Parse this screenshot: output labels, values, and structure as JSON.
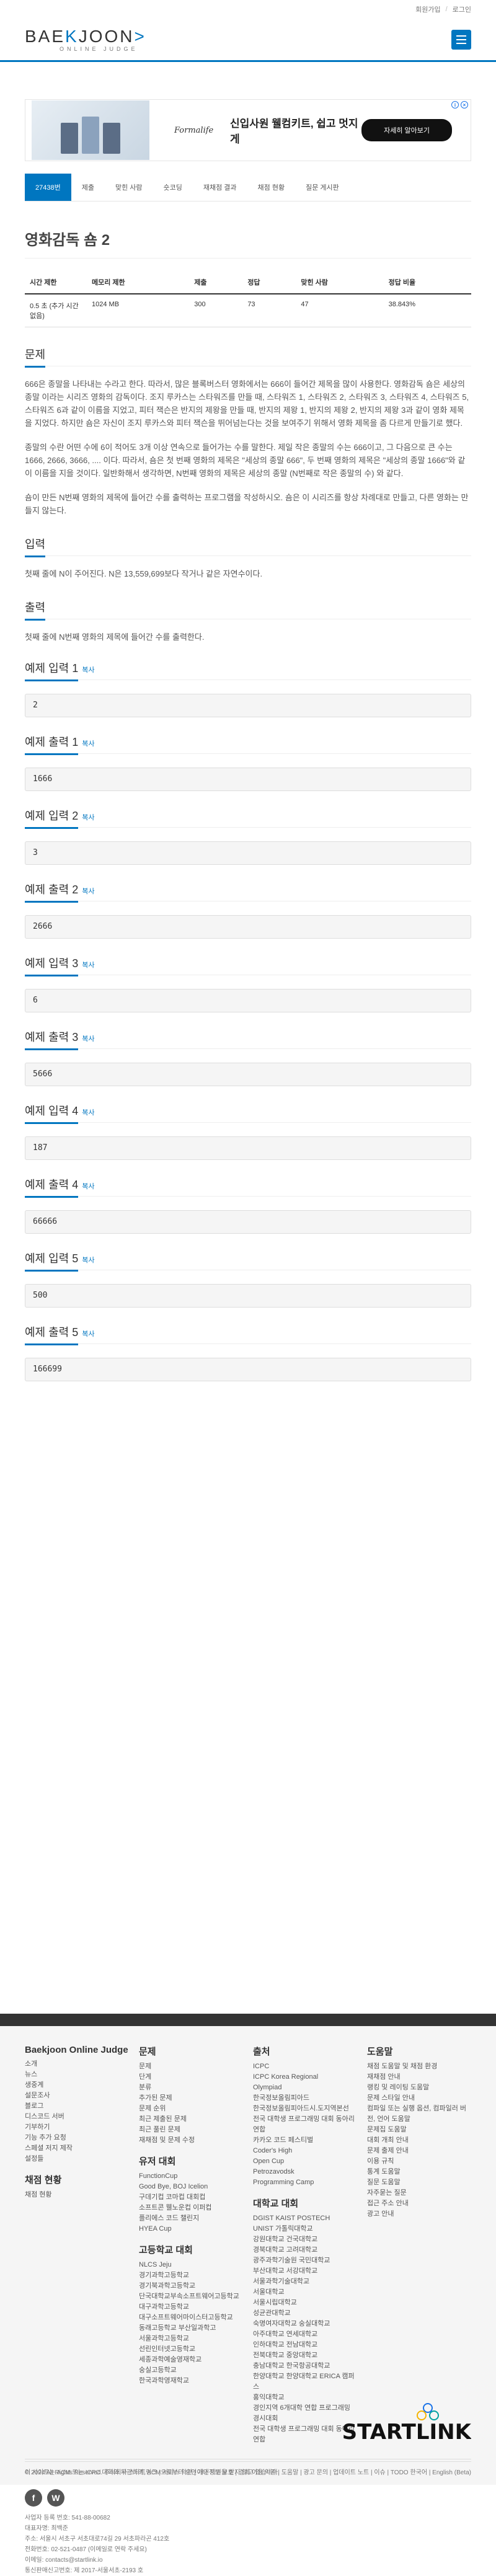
{
  "topbar": {
    "signup": "회원가입",
    "login": "로그인"
  },
  "logo": {
    "main_left": "BAE",
    "main_k": "K",
    "main_right": "JOON",
    "sub": "ONLINE JUDGE"
  },
  "ad": {
    "brand": "Formalife",
    "headline": "신입사원 웰컴키트, 쉽고 멋지게",
    "cta": "자세히 알아보기"
  },
  "tabs": [
    "27438번",
    "제출",
    "맞힌 사람",
    "숏코딩",
    "재채점 결과",
    "채점 현황",
    "질문 게시판"
  ],
  "problem": {
    "title": "영화감독 숌 2",
    "headers": [
      "시간 제한",
      "메모리 제한",
      "제출",
      "정답",
      "맞힌 사람",
      "정답 비율"
    ],
    "values": [
      "0.5 초 (추가 시간 없음)",
      "1024 MB",
      "300",
      "73",
      "47",
      "38.843%"
    ]
  },
  "sections": {
    "desc_title": "문제",
    "desc_p1": "666은 종말을 나타내는 수라고 한다. 따라서, 많은 블록버스터 영화에서는 666이 들어간 제목을 많이 사용한다. 영화감독 숌은 세상의 종말 이라는 시리즈 영화의 감독이다. 조지 루카스는 스타워즈를 만들 때, 스타워즈 1, 스타워즈 2, 스타워즈 3, 스타워즈 4, 스타워즈 5, 스타워즈 6과 같이 이름을 지었고, 피터 잭슨은 반지의 제왕을 만들 때, 반지의 제왕 1, 반지의 제왕 2, 반지의 제왕 3과 같이 영화 제목을 지었다. 하지만 숌은 자신이 조지 루카스와 피터 잭슨을 뛰어넘는다는 것을 보여주기 위해서 영화 제목을 좀 다르게 만들기로 했다.",
    "desc_p2": "종말의 수란 어떤 수에 6이 적어도 3개 이상 연속으로 들어가는 수를 말한다. 제일 작은 종말의 수는 666이고, 그 다음으로 큰 수는 1666, 2666, 3666, .... 이다. 따라서, 숌은 첫 번째 영화의 제목은 \"세상의 종말 666\", 두 번째 영화의 제목은 \"세상의 종말 1666\"와 같이 이름을 지을 것이다. 일반화해서 생각하면, N번째 영화의 제목은 세상의 종말 (N번째로 작은 종말의 수) 와 같다.",
    "desc_p3": "숌이 만든 N번째 영화의 제목에 들어간 수를 출력하는 프로그램을 작성하시오. 숌은 이 시리즈를 항상 차례대로 만들고, 다른 영화는 만들지 않는다.",
    "input_title": "입력",
    "input_p": "첫째 줄에 N이 주어진다. N은 13,559,699보다 작거나 같은 자연수이다.",
    "output_title": "출력",
    "output_p": "첫째 줄에 N번째 영화의 제목에 들어간 수를 출력한다."
  },
  "samples": [
    {
      "title": "예제 입력 1",
      "copy": "복사",
      "value": "2"
    },
    {
      "title": "예제 출력 1",
      "copy": "복사",
      "value": "1666"
    },
    {
      "title": "예제 입력 2",
      "copy": "복사",
      "value": "3"
    },
    {
      "title": "예제 출력 2",
      "copy": "복사",
      "value": "2666"
    },
    {
      "title": "예제 입력 3",
      "copy": "복사",
      "value": "6"
    },
    {
      "title": "예제 출력 3",
      "copy": "복사",
      "value": "5666"
    },
    {
      "title": "예제 입력 4",
      "copy": "복사",
      "value": "187"
    },
    {
      "title": "예제 출력 4",
      "copy": "복사",
      "value": "66666"
    },
    {
      "title": "예제 입력 5",
      "copy": "복사",
      "value": "500"
    },
    {
      "title": "예제 출력 5",
      "copy": "복사",
      "value": "166699"
    }
  ],
  "footer": {
    "col1": {
      "title": "Baekjoon Online Judge",
      "links": [
        "소개",
        "뉴스",
        "생중계",
        "설문조사",
        "블로그",
        "디스코드 서버",
        "기부하기",
        "기능 추가 요청",
        "스페셜 저지 제작",
        "설정들"
      ],
      "title2": "채점 현황",
      "links2": [
        "채점 현황"
      ]
    },
    "col2": {
      "title": "문제",
      "links": [
        "문제",
        "단계",
        "분류",
        "추가된 문제",
        "문제 순위",
        "최근 제출된 문제",
        "최근 풀린 문제",
        "재채점 및 문제 수정"
      ],
      "title2": "유저 대회",
      "links2": [
        "FunctionCup",
        "Good Bye, BOJ Icelion",
        "구데기컵 코마컵 대회컵",
        "소프트콘 웰노운컵 이퍼컵",
        "플리에스 코드 챌린지",
        "HYEA Cup"
      ],
      "title3": "고등학교 대회",
      "links3": [
        "NLCS Jeju",
        "경기과학고등학교",
        "경기북과학고등학교",
        "단국대학교부속소프트웨어고등학교",
        "대구과학고등학교",
        "대구소프트웨어마이스터고등학교",
        "동래고등학교 부산일과학고",
        "서울과학고등학교",
        "선린인터넷고등학교",
        "세종과학예술영재학교",
        "숭실고등학교",
        "한국과학영재학교"
      ]
    },
    "col3": {
      "title": "출처",
      "links": [
        "ICPC",
        "ICPC Korea Regional",
        "Olympiad",
        "한국정보올림피아드",
        "한국정보올림피아드시.도지역본선",
        "전국 대학생 프로그래밍 대회 동아리 연합",
        "카카오 코드 페스티벌",
        "Coder's High",
        "Open Cup",
        "Petrozavodsk",
        "Programming Camp"
      ],
      "title2": "대학교 대회",
      "links2": [
        "DGIST KAIST POSTECH",
        "UNIST 가톨릭대학교",
        "강원대학교 건국대학교",
        "경북대학교 고려대학교",
        "광주과학기술원 국민대학교",
        "부산대학교 서강대학교",
        "서울과학기술대학교",
        "서울대학교",
        "서울시립대학교",
        "성균관대학교",
        "숙명여자대학교 숭실대학교",
        "아주대학교 연세대학교",
        "인하대학교 전남대학교",
        "전북대학교 중앙대학교",
        "충남대학교 한국항공대학교",
        "한양대학교 한양대학교 ERICA 캠퍼스",
        "홍익대학교",
        "경인지역 6개대학 연합 프로그래밍 경시대회",
        "전국 대학생 프로그래밍 대회 동아리 연합"
      ]
    },
    "col4": {
      "title": "도움말",
      "links": [
        "채점 도움말 및 채점 환경",
        "재채점 안내",
        "랭킹 및 레이팅 도움말",
        "문제 스타일 안내",
        "컴파일 또는 실행 옵션, 컴파일러 버전, 언어 도움말",
        "문제집 도움말",
        "대회 개최 안내",
        "문제 출제 안내",
        "이용 규칙",
        "통계 도움말",
        "질문 도움말",
        "자주묻는 질문",
        "접근 주소 안내",
        "광고 안내"
      ]
    },
    "copyright": "© 2024 All Rights Reserved. 주식회사 스타트링크  |  서비스 약관  |  개인정보 보호  |  결제 이용 약관  |  도움말  |  광고 문의  |  업데이트 노트  |  이슈  |  TODO",
    "biz": "사업자 등록 번호: 541-88-00682\n대표자명: 최백준\n주소: 서울시 서초구 서초대로74길 29 서초파라곤 412호\n전화번호: 02-521-0487 (이메일로 연락 주세요)\n이메일: contacts@startlink.io\n통신판매신고번호: 제 2017-서울서초-2193 호",
    "bottom_left": "이 사이트는 ACM 또는 ICPC 대회와 무관하며, ACM으로부터 승인이나 지원을 받지 않고 있습니다.",
    "bottom_right": "한국어  |  English (Beta)",
    "startlink": "STARTLINK"
  }
}
